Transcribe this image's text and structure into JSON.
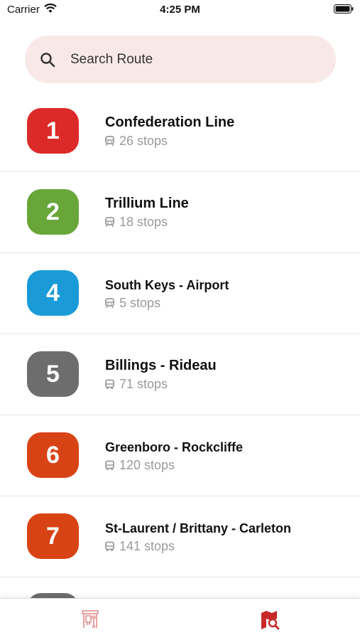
{
  "status_bar": {
    "carrier": "Carrier",
    "time": "4:25 PM"
  },
  "search": {
    "placeholder": "Search Route"
  },
  "routes": [
    {
      "number": "1",
      "name": "Confederation Line",
      "stops": "26 stops",
      "color": "#dc2a28",
      "vehicle_icon": "train-icon"
    },
    {
      "number": "2",
      "name": "Trillium Line",
      "stops": "18 stops",
      "color": "#68a63a",
      "vehicle_icon": "train-icon"
    },
    {
      "number": "4",
      "name": "South Keys - Airport",
      "stops": "5 stops",
      "color": "#1a9bd8",
      "vehicle_icon": "train-icon"
    },
    {
      "number": "5",
      "name": "Billings - Rideau",
      "stops": "71 stops",
      "color": "#6d6d6d",
      "vehicle_icon": "bus-icon"
    },
    {
      "number": "6",
      "name": "Greenboro - Rockcliffe",
      "stops": "120 stops",
      "color": "#d84315",
      "vehicle_icon": "bus-icon"
    },
    {
      "number": "7",
      "name": "St-Laurent / Brittany - Carleton",
      "stops": "141 stops",
      "color": "#d84315",
      "vehicle_icon": "bus-icon"
    }
  ],
  "tab_bar": {
    "tabs": [
      {
        "icon": "bus-stop-icon",
        "selected": false
      },
      {
        "icon": "map-search-icon",
        "selected": true
      }
    ],
    "active_color": "#c62828",
    "inactive_color": "#e8a1a1"
  }
}
